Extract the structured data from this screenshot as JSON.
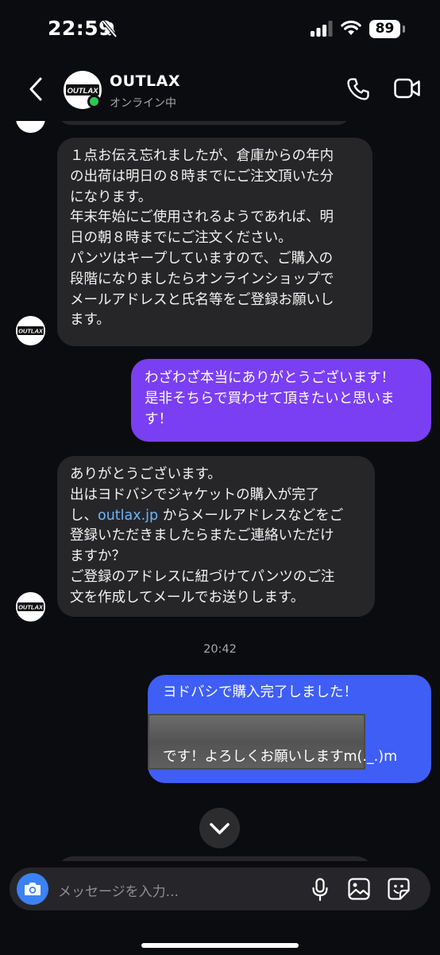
{
  "status_bar": {
    "time": "22:59",
    "battery": "89"
  },
  "header": {
    "name": "OUTLAX",
    "status": "オンライン中",
    "avatar_text": "OUTLAX"
  },
  "messages": [
    {
      "lines": [
        "１点お伝え忘れましたが、倉庫からの年内",
        "の出荷は明日の８時までにご注文頂いた分",
        "になります。",
        "年末年始にご使用されるようであれば、明",
        "日の朝８時までにご注文ください。",
        "パンツはキープしていますので、ご購入の",
        "段階になりましたらオンラインショップで",
        "メールアドレスと氏名等をご登録お願いし",
        "ます。"
      ]
    },
    {
      "lines": [
        "わざわざ本当にありがとうございます！",
        "是非そちらで買わせて頂きたいと思いま",
        "す！"
      ]
    },
    {
      "line1": "ありがとうございます。",
      "line2": "出はヨドバシでジャケットの購入が完了",
      "line3_pre": "し、",
      "link": "outlax.jp",
      "line3_post": " からメールアドレスなどをご",
      "line4": "登録いただきましたらまたご連絡いただけ",
      "line5": "ますか？",
      "line6": "ご登録のアドレスに紐づけてパンツのご注",
      "line7": "文を作成してメールでお送りします。"
    },
    {
      "line1": "ヨドバシで購入完了しました！",
      "line3": "です！よろしくお願いしますm(._.)m"
    }
  ],
  "timestamp": "20:42",
  "composer": {
    "placeholder": "メッセージを入力..."
  },
  "colors": {
    "outgoing_purple": "#7a3ff2",
    "outgoing_blue": "#3f5ef5",
    "incoming": "#262628",
    "link": "#6cb4ff",
    "online": "#2fc654"
  }
}
